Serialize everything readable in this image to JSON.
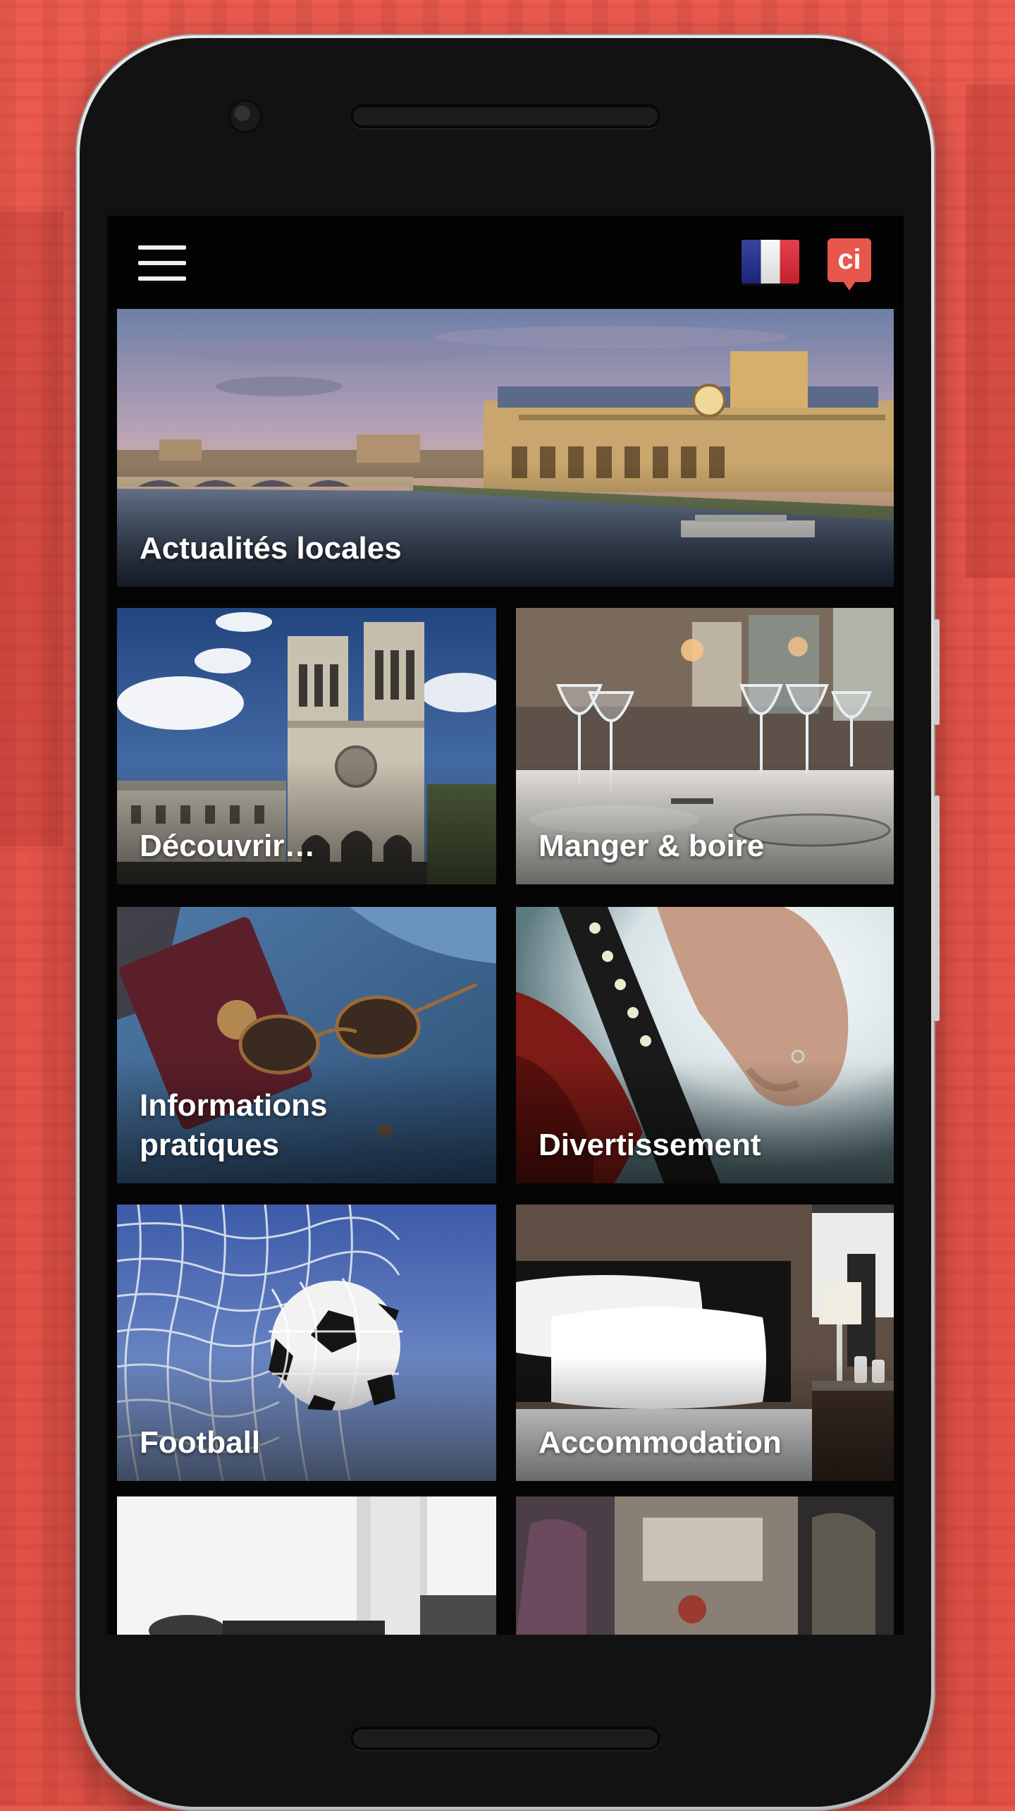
{
  "header": {
    "menu_icon": "hamburger-menu-icon",
    "language_flag": "france-flag-icon",
    "app_logo_text": "ci"
  },
  "tiles": [
    {
      "label": "Actualités locales",
      "image": "paris-seine-orsay-photo"
    },
    {
      "label": "Découvrir…",
      "image": "notre-dame-photo"
    },
    {
      "label": "Manger & boire",
      "image": "restaurant-table-photo"
    },
    {
      "label": "Informations\npratiques",
      "image": "passport-sunglasses-photo"
    },
    {
      "label": "Divertissement",
      "image": "guitar-hand-photo"
    },
    {
      "label": "Football",
      "image": "football-net-photo"
    },
    {
      "label": "Accommodation",
      "image": "hotel-bed-photo"
    },
    {
      "label": "",
      "image": "microphone-photo"
    },
    {
      "label": "",
      "image": "metro-train-photo"
    }
  ],
  "colors": {
    "background": "#e8574b",
    "screen": "#050505",
    "logo": "#e8574b"
  }
}
